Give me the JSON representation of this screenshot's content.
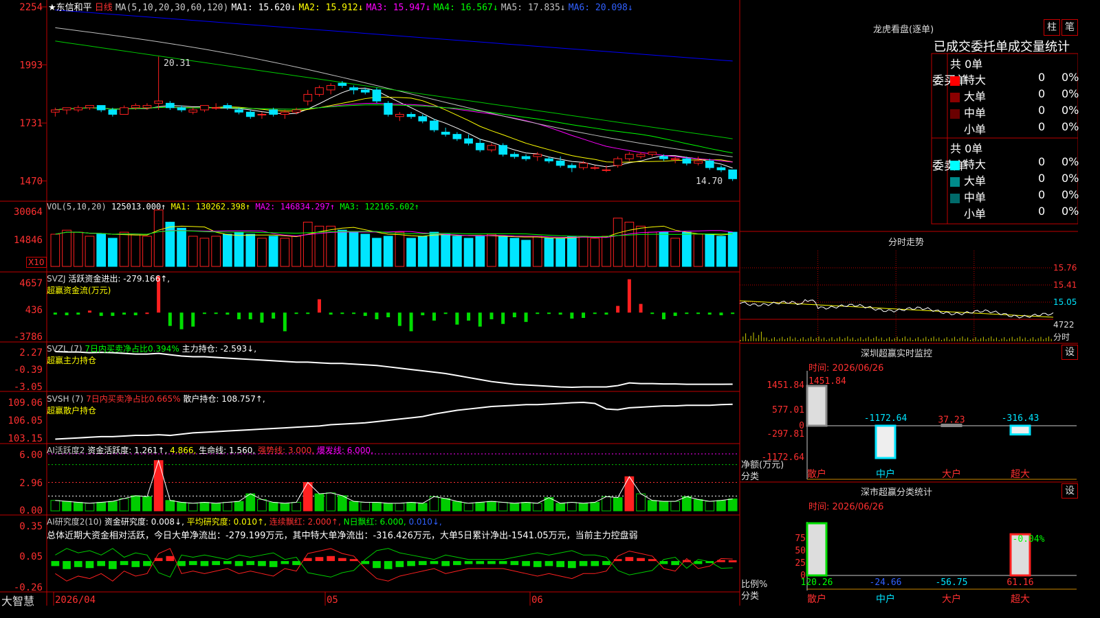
{
  "colors": {
    "up": "#ff2020",
    "down": "#00e5ff",
    "ma1": "#ffffff",
    "ma2": "#ffff00",
    "ma3": "#ff00ff",
    "ma4": "#00ff00",
    "ma5": "#c0c0c0",
    "ma6": "#0000ff",
    "grid": "#c00000",
    "green": "#00dd00"
  },
  "header": {
    "star_title": "★东信和平",
    "period": "日线",
    "ma_params": "MA(5,10,20,30,60,120)",
    "ma1": "MA1: 15.620↓",
    "ma2": "MA2: 15.912↓",
    "ma3": "MA3: 15.947↓",
    "ma4": "MA4: 16.567↓",
    "ma5": "MA5: 17.835↓",
    "ma6": "MA6: 20.098↓"
  },
  "price_axis": [
    "2254",
    "1993",
    "1731",
    "1470"
  ],
  "price_marks": {
    "high": "20.31",
    "low": "14.70"
  },
  "vol": {
    "label": "VOL(5,10,20)",
    "value": "125013.000↑",
    "ma1": "MA1: 130262.398↑",
    "ma2": "MA2: 146834.297↑",
    "ma3": "MA3: 122165.602↑",
    "axis": [
      "30064",
      "14846"
    ],
    "unit": "X10"
  },
  "svzj": {
    "label": "SVZJ",
    "text": "活跃资金进出: -279.166↑,",
    "name": "超赢资金流(万元)",
    "axis": [
      "4657",
      "436",
      "-3786"
    ]
  },
  "svzl": {
    "label": "SVZL (7)",
    "text1": "7日内买卖净占比0.394%",
    "text2": "主力持仓: -2.593↓,",
    "name": "超赢主力持仓",
    "axis": [
      "2.27",
      "-0.39",
      "-3.05"
    ]
  },
  "svsh": {
    "label": "SVSH (7)",
    "text1": "7日内买卖净占比0.665%",
    "text2": "散户持仓: 108.757↑,",
    "name": "超赢散户持仓",
    "axis": [
      "109.06",
      "106.05",
      "103.15"
    ]
  },
  "ai2": {
    "label": "AI活跃度2",
    "t1": "资金活跃度: 1.261↑,",
    "t2": "4.866,",
    "t3": "生命线: 1.560,",
    "t4": "强势线: 3.000,",
    "t5": "爆发线: 6.000,",
    "axis": [
      "6.00",
      "2.96",
      "0.00"
    ]
  },
  "ai_research": {
    "label": "AI研究度2(10)",
    "t1": "资金研究度: 0.008↓,",
    "t2": "平均研究度: 0.010↑,",
    "t3": "连续飘红: 2.000↑,",
    "t4": "N日飘红: 6.000,",
    "t5": "0.010↓,",
    "axis": [
      "0.35",
      "0.05",
      "-0.26"
    ],
    "summary": "总体近期大资金相对活跃，今日大单净流出：-279.199万元，其中特大单净流出：-316.426万元，大单5日累计净出-1541.05万元，当前主力控盘弱"
  },
  "date_axis": [
    "2026/04",
    "05",
    "06"
  ],
  "brand": "大智慧",
  "right": {
    "title": "龙虎看盘(逐单)",
    "tab1": "柱",
    "tab2": "笔",
    "stats_title": "已成交委托单成交量统计",
    "buy": {
      "label": "委买单",
      "total": "共 0单",
      "rows": [
        {
          "name": "特大",
          "v": "0",
          "p": "0%"
        },
        {
          "name": "大单",
          "v": "0",
          "p": "0%"
        },
        {
          "name": "中单",
          "v": "0",
          "p": "0%"
        },
        {
          "name": "小单",
          "v": "0",
          "p": "0%"
        }
      ]
    },
    "sell": {
      "label": "委卖单",
      "total": "共 0单",
      "rows": [
        {
          "name": "特大",
          "v": "0",
          "p": "0%"
        },
        {
          "name": "大单",
          "v": "0",
          "p": "0%"
        },
        {
          "name": "中单",
          "v": "0",
          "p": "0%"
        },
        {
          "name": "小单",
          "v": "0",
          "p": "0%"
        }
      ]
    },
    "intraday": {
      "title": "分时走势",
      "axis": [
        "15.76",
        "15.41",
        "15.05"
      ],
      "vol": "4722",
      "vol_label": "分时"
    },
    "monitor": {
      "title": "深圳超赢实时监控",
      "set": "设",
      "time": "时间: 2026/06/26",
      "axis": [
        "1451.84",
        "577.01",
        "0",
        "-297.81",
        "-1172.64"
      ],
      "ylabel": "净额(万元)",
      "xlabel": "分类",
      "bars": [
        {
          "cat": "散户",
          "v": "1451.84"
        },
        {
          "cat": "中户",
          "v": "-1172.64"
        },
        {
          "cat": "大户",
          "v": "37.23"
        },
        {
          "cat": "超大",
          "v": "-316.43"
        }
      ]
    },
    "classify": {
      "title": "深市超赢分类统计",
      "set": "设",
      "time": "时间: 2026/06/26",
      "axis": [
        "75",
        "50",
        "25",
        "0"
      ],
      "ylabel": "比例%",
      "xlabel": "分类",
      "top_label": "-0.04%",
      "bars": [
        {
          "cat": "散户",
          "v": "120.26"
        },
        {
          "cat": "中户",
          "v": "-24.66"
        },
        {
          "cat": "大户",
          "v": "-56.75"
        },
        {
          "cat": "超大",
          "v": "61.16"
        }
      ]
    }
  },
  "chart_data": {
    "type": "candlestick",
    "title": "东信和平 日线",
    "x": [
      "2026/04",
      "05",
      "06"
    ],
    "candles": [
      [
        17.8,
        18.0,
        17.6,
        17.9
      ],
      [
        17.9,
        18.0,
        17.7,
        18.0
      ],
      [
        17.9,
        18.1,
        17.8,
        18.0
      ],
      [
        18.0,
        18.1,
        17.9,
        18.1
      ],
      [
        18.1,
        18.1,
        17.8,
        17.9
      ],
      [
        17.9,
        18.0,
        17.6,
        17.7
      ],
      [
        17.7,
        18.1,
        17.7,
        18.0
      ],
      [
        18.0,
        18.2,
        17.9,
        18.1
      ],
      [
        18.0,
        18.2,
        17.9,
        18.1
      ],
      [
        18.2,
        20.3,
        17.9,
        18.3
      ],
      [
        18.2,
        18.3,
        17.9,
        18.0
      ],
      [
        18.0,
        18.1,
        17.8,
        17.9
      ],
      [
        17.8,
        18.0,
        17.7,
        17.9
      ],
      [
        17.9,
        18.1,
        17.8,
        18.1
      ],
      [
        18.0,
        18.2,
        17.9,
        18.0
      ],
      [
        18.1,
        18.2,
        17.9,
        18.0
      ],
      [
        17.9,
        18.0,
        17.7,
        17.8
      ],
      [
        17.8,
        17.9,
        17.5,
        17.6
      ],
      [
        17.7,
        17.8,
        17.5,
        17.7
      ],
      [
        17.9,
        18.0,
        17.6,
        17.7
      ],
      [
        17.7,
        17.9,
        17.5,
        17.8
      ],
      [
        17.8,
        18.0,
        17.7,
        17.9
      ],
      [
        18.3,
        18.8,
        18.1,
        18.6
      ],
      [
        18.6,
        19.0,
        18.5,
        18.9
      ],
      [
        18.8,
        19.1,
        18.6,
        19.0
      ],
      [
        19.1,
        19.2,
        18.9,
        19.0
      ],
      [
        18.9,
        19.0,
        18.6,
        18.8
      ],
      [
        18.8,
        18.9,
        18.6,
        18.7
      ],
      [
        18.8,
        18.9,
        18.2,
        18.3
      ],
      [
        18.2,
        18.3,
        17.6,
        17.7
      ],
      [
        17.6,
        17.8,
        17.4,
        17.7
      ],
      [
        17.7,
        17.8,
        17.5,
        17.6
      ],
      [
        17.6,
        17.7,
        17.3,
        17.4
      ],
      [
        17.4,
        17.5,
        16.9,
        17.0
      ],
      [
        16.9,
        17.1,
        16.7,
        16.8
      ],
      [
        16.8,
        16.9,
        16.5,
        16.6
      ],
      [
        16.6,
        16.8,
        16.3,
        16.4
      ],
      [
        16.4,
        16.6,
        16.0,
        16.1
      ],
      [
        16.1,
        16.4,
        16.0,
        16.3
      ],
      [
        16.3,
        16.4,
        15.8,
        15.9
      ],
      [
        15.9,
        16.0,
        15.7,
        15.8
      ],
      [
        15.8,
        15.9,
        15.6,
        15.7
      ],
      [
        15.8,
        16.0,
        15.6,
        15.9
      ],
      [
        15.7,
        15.8,
        15.5,
        15.6
      ],
      [
        15.6,
        15.8,
        15.3,
        15.4
      ],
      [
        15.4,
        15.5,
        15.1,
        15.3
      ],
      [
        15.3,
        15.6,
        15.2,
        15.5
      ],
      [
        15.3,
        15.4,
        15.2,
        15.3
      ],
      [
        15.2,
        15.4,
        15.1,
        15.2
      ],
      [
        15.4,
        15.8,
        15.3,
        15.7
      ],
      [
        15.7,
        16.0,
        15.6,
        15.9
      ],
      [
        15.8,
        16.0,
        15.7,
        15.9
      ],
      [
        15.9,
        16.0,
        15.8,
        16.0
      ],
      [
        15.8,
        15.9,
        15.6,
        15.7
      ],
      [
        15.7,
        15.8,
        15.5,
        15.7
      ],
      [
        15.7,
        15.8,
        15.4,
        15.5
      ],
      [
        15.5,
        15.8,
        15.4,
        15.6
      ],
      [
        15.6,
        15.7,
        15.2,
        15.3
      ],
      [
        15.3,
        15.4,
        15.1,
        15.2
      ],
      [
        15.2,
        15.2,
        14.7,
        14.8
      ]
    ],
    "volume": [
      16,
      18,
      17,
      15,
      16,
      14,
      17,
      16,
      15,
      28,
      22,
      19,
      15,
      14,
      15,
      16,
      17,
      16,
      14,
      15,
      14,
      15,
      22,
      20,
      20,
      18,
      17,
      16,
      14,
      15,
      17,
      14,
      15,
      17,
      16,
      15,
      14,
      15,
      16,
      15,
      14,
      13,
      15,
      14,
      14,
      15,
      15,
      14,
      15,
      24,
      22,
      20,
      17,
      17,
      14,
      17,
      16,
      16,
      15,
      17
    ],
    "svzj": [
      -300,
      -400,
      -300,
      300,
      -500,
      -500,
      -300,
      -400,
      0,
      5500,
      -2000,
      -2500,
      -2100,
      -200,
      -100,
      -300,
      -1000,
      -1000,
      -1500,
      -900,
      -2800,
      -200,
      -200,
      2000,
      -300,
      -200,
      -100,
      -500,
      -1000,
      -700,
      -2000,
      -2800,
      -400,
      -1200,
      -200,
      -1800,
      -1200,
      -2100,
      -1000,
      -1700,
      -700,
      -1400,
      -200,
      -200,
      -300,
      -900,
      -800,
      -200,
      -300,
      1000,
      5000,
      1300,
      -200,
      -1000,
      -500,
      -200,
      -200,
      -300,
      -400,
      -200
    ],
    "svzl": [
      2.27,
      2.2,
      2.2,
      2.1,
      2.15,
      2.1,
      2.0,
      1.9,
      1.9,
      2.0,
      1.8,
      1.6,
      1.5,
      1.5,
      1.4,
      1.3,
      1.2,
      1.1,
      1.0,
      0.9,
      0.8,
      0.7,
      0.7,
      0.6,
      0.5,
      0.5,
      0.4,
      0.3,
      0.2,
      0.0,
      -0.2,
      -0.4,
      -0.6,
      -0.8,
      -1.0,
      -1.3,
      -1.6,
      -1.9,
      -2.2,
      -2.4,
      -2.6,
      -2.7,
      -2.8,
      -2.9,
      -3.0,
      -3.05,
      -3.0,
      -3.0,
      -3.0,
      -2.8,
      -2.4,
      -2.5,
      -2.5,
      -2.55,
      -2.55,
      -2.6,
      -2.6,
      -2.6,
      -2.6,
      -2.59
    ],
    "svsh": [
      103.2,
      103.3,
      103.4,
      103.5,
      103.6,
      103.6,
      103.7,
      103.8,
      103.8,
      103.9,
      103.8,
      104.0,
      104.2,
      104.3,
      104.4,
      104.5,
      104.6,
      104.7,
      104.8,
      104.9,
      105.0,
      105.1,
      105.2,
      105.3,
      105.5,
      105.6,
      105.7,
      105.8,
      106.0,
      106.2,
      106.4,
      106.6,
      106.8,
      107.2,
      107.5,
      107.8,
      108.0,
      108.2,
      108.4,
      108.5,
      108.6,
      108.7,
      108.7,
      108.8,
      108.9,
      109.0,
      109.06,
      108.9,
      108.0,
      107.9,
      108.2,
      108.3,
      108.4,
      108.5,
      108.5,
      108.6,
      108.6,
      108.6,
      108.7,
      108.76
    ],
    "ai2": [
      1.1,
      1.0,
      0.9,
      0.8,
      0.9,
      1.0,
      1.3,
      1.6,
      1.5,
      5.3,
      1.1,
      0.9,
      0.8,
      0.9,
      0.8,
      0.9,
      1.0,
      1.8,
      1.2,
      0.9,
      0.8,
      0.9,
      3.0,
      1.8,
      1.9,
      1.6,
      1.0,
      0.9,
      0.9,
      0.8,
      0.8,
      0.9,
      0.8,
      1.5,
      1.3,
      1.0,
      0.8,
      0.9,
      1.0,
      0.9,
      0.8,
      0.9,
      0.8,
      1.4,
      0.8,
      0.9,
      0.8,
      0.9,
      1.5,
      1.4,
      3.6,
      1.8,
      1.1,
      1.0,
      1.0,
      1.5,
      1.2,
      1.0,
      1.1,
      1.26
    ],
    "ai_research": [
      -0.05,
      -0.08,
      -0.06,
      -0.07,
      -0.05,
      -0.08,
      -0.04,
      -0.06,
      -0.05,
      0.03,
      0.05,
      -0.05,
      -0.04,
      -0.05,
      -0.04,
      -0.03,
      -0.05,
      -0.04,
      -0.05,
      -0.06,
      -0.03,
      -0.04,
      0.03,
      0.04,
      0.05,
      0.03,
      0.02,
      -0.03,
      -0.07,
      -0.08,
      -0.06,
      -0.05,
      -0.04,
      -0.03,
      -0.05,
      -0.04,
      -0.03,
      -0.03,
      -0.03,
      -0.03,
      -0.04,
      -0.05,
      -0.06,
      -0.05,
      -0.06,
      -0.07,
      -0.05,
      -0.05,
      -0.04,
      0.02,
      0.04,
      0.03,
      0.02,
      -0.03,
      -0.04,
      0.01,
      -0.03,
      -0.02,
      0.01,
      0.008
    ]
  }
}
